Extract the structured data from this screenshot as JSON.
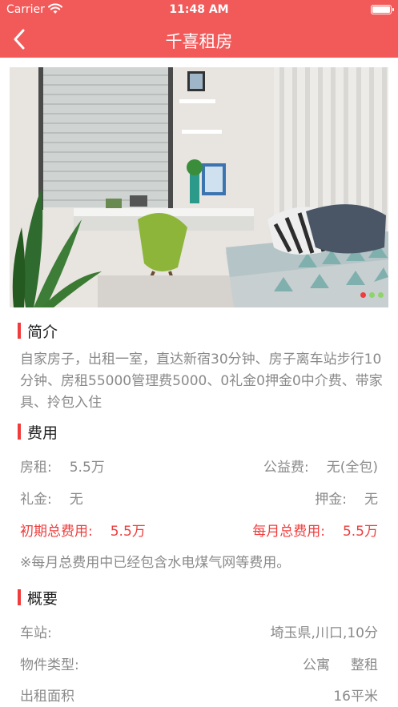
{
  "status_bar": {
    "carrier": "Carrier",
    "time": "11:48 AM"
  },
  "nav": {
    "title": "千喜租房"
  },
  "gallery": {
    "total": 3,
    "current": 1,
    "dot_colors": [
      "#f03c3c",
      "#8fd46a",
      "#8fd46a"
    ]
  },
  "intro": {
    "heading": "简介",
    "text": "自家房子，出租一室，直达新宿30分钟、房子离车站步行10分钟、房租55000管理费5000、0礼金0押金0中介费、带家具、拎包入住"
  },
  "fees": {
    "heading": "费用",
    "rent_label": "房租:",
    "rent_value": "5.5万",
    "public_label": "公益费:",
    "public_value": "无(全包)",
    "key_money_label": "礼金:",
    "key_money_value": "无",
    "deposit_label": "押金:",
    "deposit_value": "无",
    "initial_label": "初期总费用:",
    "initial_value": "5.5万",
    "monthly_label": "每月总费用:",
    "monthly_value": "5.5万",
    "note": "※每月总费用中已经包含水电煤气网等费用。"
  },
  "overview": {
    "heading": "概要",
    "station_label": "车站:",
    "station_value": "埼玉県,川口,10分",
    "type_label": "物件类型:",
    "type_value_1": "公寓",
    "type_value_2": "整租",
    "area_label": "出租面积",
    "area_value": "16平米"
  },
  "colors": {
    "accent": "#f25a5a",
    "highlight": "#f03c3c",
    "muted_text": "#8a8a8a"
  }
}
